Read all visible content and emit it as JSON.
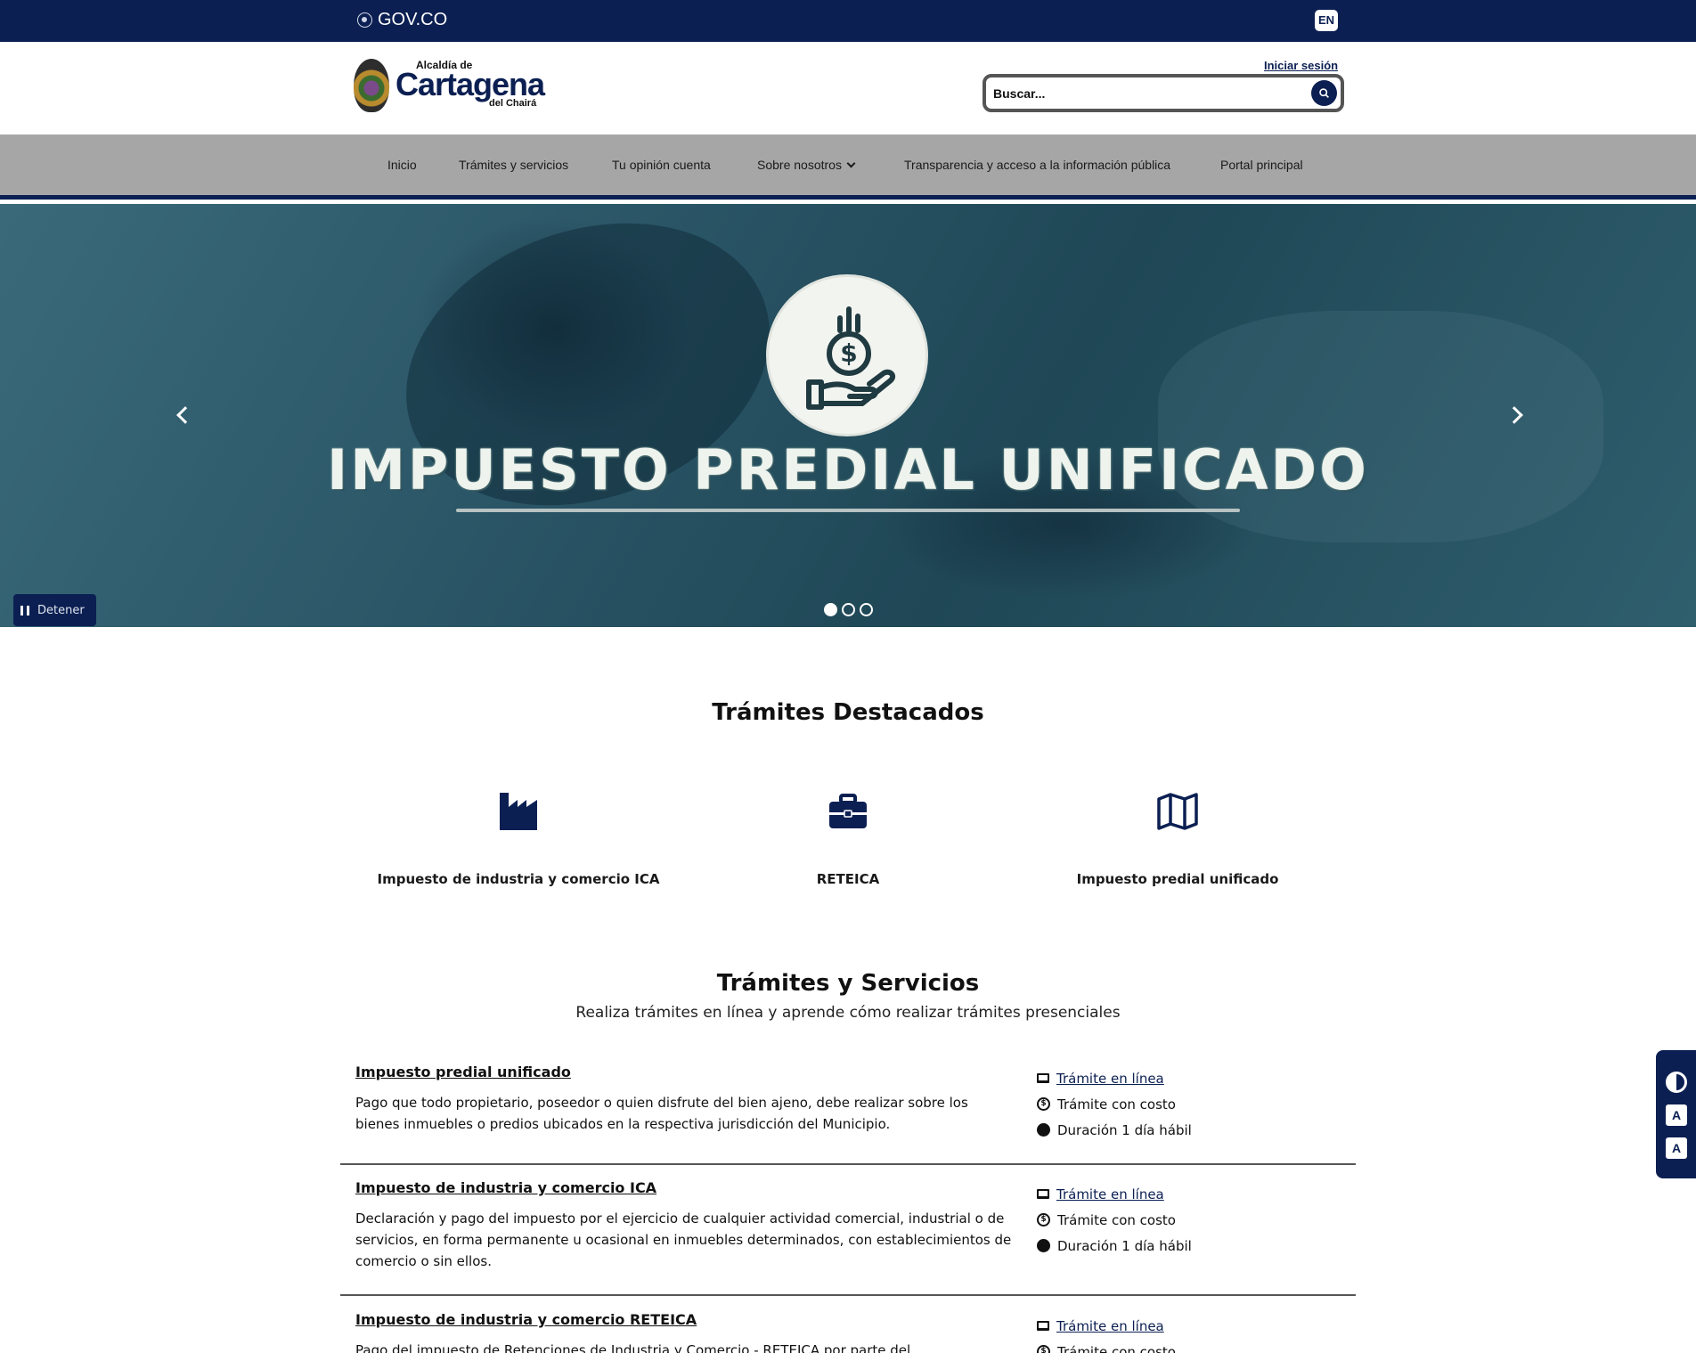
{
  "govbar": {
    "brand": "GOV.CO",
    "lang": "EN"
  },
  "header": {
    "logo": {
      "line1": "Alcaldía de",
      "line2": "Cartagena",
      "line3": "del Chairá"
    },
    "login_label": "Iniciar sesión",
    "search_placeholder": "Buscar..."
  },
  "nav": {
    "items": [
      {
        "label": "Inicio"
      },
      {
        "label": "Trámites y servicios"
      },
      {
        "label": "Tu opinión cuenta"
      },
      {
        "label": "Sobre nosotros"
      },
      {
        "label": "Transparencia y acceso a la información pública"
      },
      {
        "label": "Portal principal"
      }
    ]
  },
  "hero": {
    "title": "IMPUESTO PREDIAL UNIFICADO",
    "pause_label": "Detener",
    "slides": 3,
    "active_slide": 1
  },
  "featured": {
    "title": "Trámites Destacados",
    "items": [
      {
        "label": "Impuesto de industria y comercio ICA",
        "icon": "factory-icon"
      },
      {
        "label": "RETEICA",
        "icon": "briefcase-icon"
      },
      {
        "label": "Impuesto predial unificado",
        "icon": "map-icon"
      }
    ]
  },
  "services": {
    "title": "Trámites y Servicios",
    "subtitle": "Realiza trámites en línea y aprende cómo realizar trámites presenciales",
    "items": [
      {
        "title": "Impuesto predial unificado",
        "description": "Pago que todo propietario, poseedor o quien disfrute del bien ajeno, debe realizar sobre los bienes inmuebles o predios ubicados en la respectiva jurisdicción del Municipio.",
        "online": "Trámite en línea",
        "cost": "Trámite con costo",
        "duration": "Duración 1 día hábil"
      },
      {
        "title": "Impuesto de industria y comercio ICA",
        "description": "Declaración y pago del impuesto por el ejercicio de cualquier actividad comercial, industrial o de servicios, en forma permanente u ocasional en inmuebles determinados, con establecimientos de comercio o sin ellos.",
        "online": "Trámite en línea",
        "cost": "Trámite con costo",
        "duration": "Duración 1 día hábil"
      },
      {
        "title": "Impuesto de industria y comercio RETEICA",
        "description": "Pago del impuesto de Retenciones de Industria y Comercio - RETEICA por parte del",
        "online": "Trámite en línea",
        "cost": "Trámite con costo"
      }
    ]
  },
  "a11y": {
    "font_decrease": "A",
    "font_increase": "A"
  },
  "colors": {
    "brand": "#0b1f52",
    "nav_bg": "#a6a6a6"
  }
}
